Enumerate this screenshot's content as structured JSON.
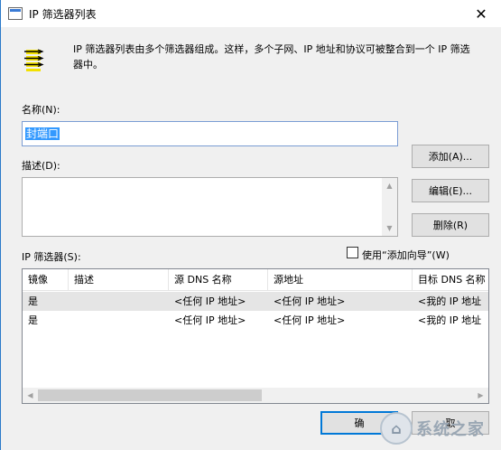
{
  "window": {
    "title": "IP 筛选器列表",
    "close_glyph": "✕"
  },
  "description": {
    "icon": "filter-list-icon",
    "text": "IP 筛选器列表由多个筛选器组成。这样，多个子网、IP 地址和协议可被整合到一个 IP 筛选器中。"
  },
  "name": {
    "label": "名称(N):",
    "value": "封端口"
  },
  "desc_field": {
    "label": "描述(D):",
    "value": ""
  },
  "buttons": {
    "add": "添加(A)...",
    "edit": "编辑(E)...",
    "delete": "删除(R)"
  },
  "filters": {
    "label": "IP 筛选器(S):",
    "wizard_checkbox": {
      "label": "使用“添加向导”(W)",
      "checked": false
    },
    "columns": [
      "镜像",
      "描述",
      "源 DNS 名称",
      "源地址",
      "目标 DNS 名称"
    ],
    "rows": [
      [
        "是",
        "",
        "<任何 IP 地址>",
        "<任何 IP 地址>",
        "<我的 IP 地址"
      ],
      [
        "是",
        "",
        "<任何 IP 地址>",
        "<任何 IP 地址>",
        "<我的 IP 地址"
      ]
    ]
  },
  "footer": {
    "ok_label": "确",
    "cancel_label": "取"
  },
  "watermark": {
    "text": "系统之家"
  },
  "colors": {
    "accent": "#0078d7",
    "selection": "#3399ff",
    "title_border": "#2b79c9"
  }
}
